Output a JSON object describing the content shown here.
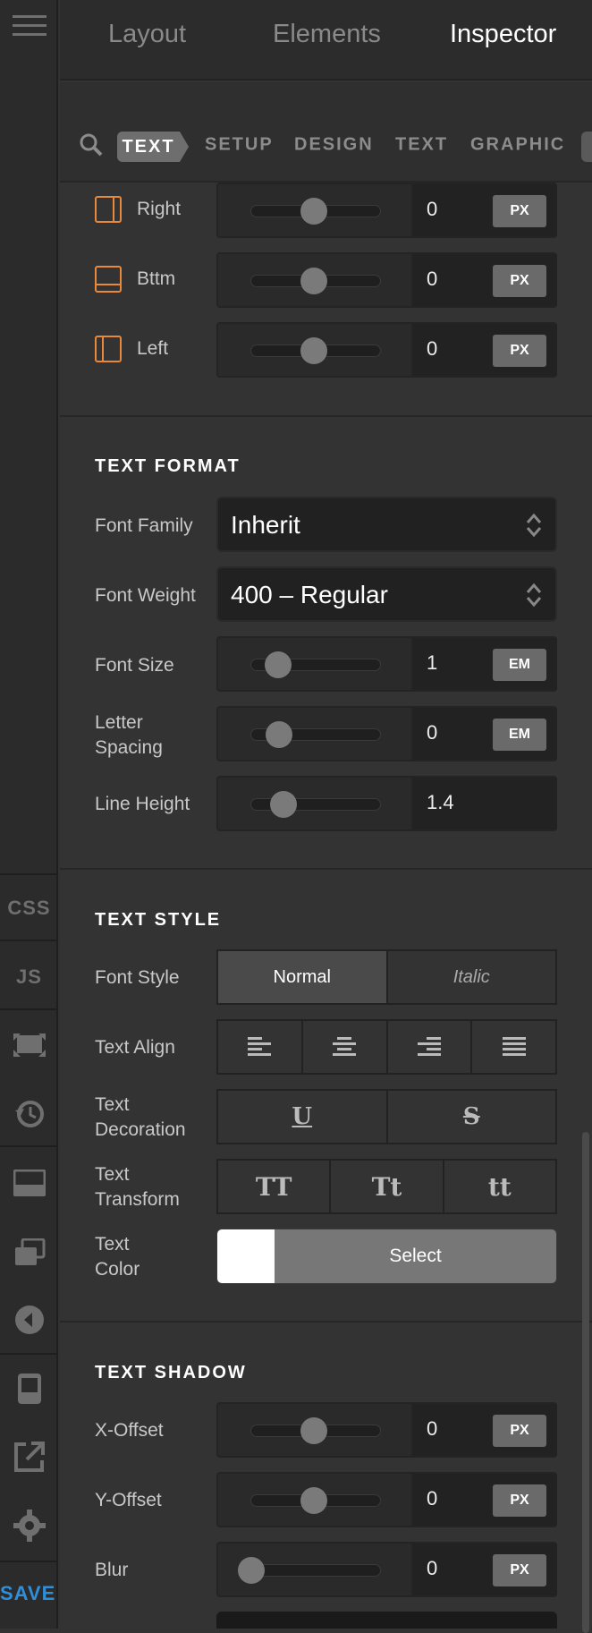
{
  "leftbar": {
    "css_label": "CSS",
    "js_label": "JS",
    "save_label": "SAVE",
    "icons": [
      "menu-icon",
      "resize-icon",
      "history-icon",
      "panel-icon",
      "layers-icon",
      "back-icon",
      "device-icon",
      "external-link-icon",
      "gear-icon"
    ]
  },
  "header": {
    "tabs": [
      {
        "label": "Layout"
      },
      {
        "label": "Elements"
      },
      {
        "label": "Inspector"
      }
    ],
    "active_tab": "Inspector"
  },
  "subtabs": {
    "active": "TEXT",
    "items": [
      "SETUP",
      "DESIGN",
      "TEXT",
      "GRAPHIC"
    ]
  },
  "border": {
    "rows": [
      {
        "label": "Right",
        "value": "0",
        "unit": "PX"
      },
      {
        "label": "Bttm",
        "value": "0",
        "unit": "PX"
      },
      {
        "label": "Left",
        "value": "0",
        "unit": "PX"
      }
    ]
  },
  "text_format": {
    "title": "TEXT FORMAT",
    "font_family_label": "Font Family",
    "font_family_value": "Inherit",
    "font_weight_label": "Font Weight",
    "font_weight_value": "400 – Regular",
    "font_size_label": "Font Size",
    "font_size_value": "1",
    "font_size_unit": "EM",
    "letter_spacing_label_1": "Letter",
    "letter_spacing_label_2": "Spacing",
    "letter_spacing_value": "0",
    "letter_spacing_unit": "EM",
    "line_height_label": "Line Height",
    "line_height_value": "1.4"
  },
  "text_style": {
    "title": "TEXT STYLE",
    "font_style_label": "Font Style",
    "font_style_normal": "Normal",
    "font_style_italic": "Italic",
    "text_align_label": "Text Align",
    "text_decoration_label_1": "Text",
    "text_decoration_label_2": "Decoration",
    "text_decoration_underline": "U",
    "text_decoration_strike": "S",
    "text_transform_label_1": "Text",
    "text_transform_label_2": "Transform",
    "text_transform_upper": "TT",
    "text_transform_capital": "Tt",
    "text_transform_lower": "tt",
    "text_color_label_1": "Text",
    "text_color_label_2": "Color",
    "text_color_select": "Select",
    "text_color_swatch": "#ffffff"
  },
  "text_shadow": {
    "title": "TEXT SHADOW",
    "x_offset_label": "X-Offset",
    "x_offset_value": "0",
    "x_offset_unit": "PX",
    "y_offset_label": "Y-Offset",
    "y_offset_value": "0",
    "y_offset_unit": "PX",
    "blur_label": "Blur",
    "blur_value": "0",
    "blur_unit": "PX"
  },
  "colors": {
    "accent_orange": "#e8883a",
    "save_blue": "#2f8fd8"
  }
}
